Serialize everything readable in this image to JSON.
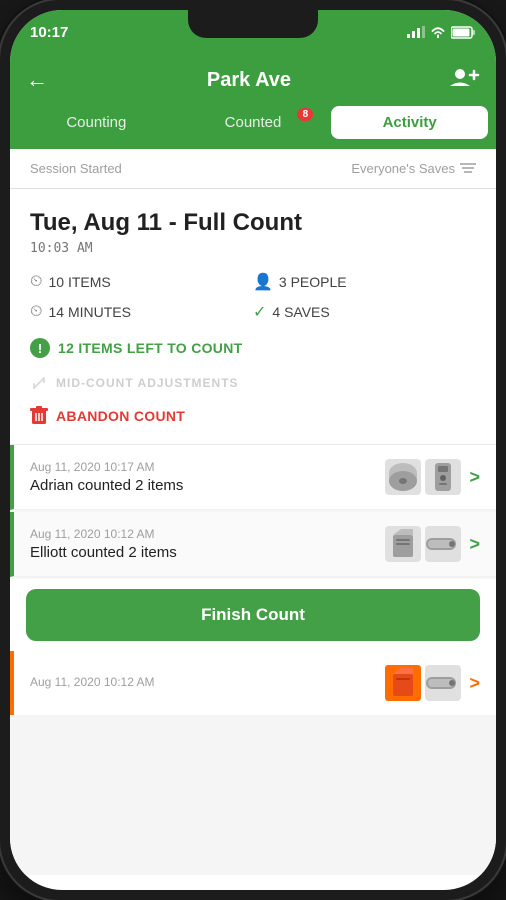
{
  "status_bar": {
    "time": "10:17",
    "signal": "▂▄▆",
    "wifi": "WiFi",
    "battery": "Battery"
  },
  "header": {
    "back_icon": "←",
    "title": "Park Ave",
    "add_icon": "👥+"
  },
  "tabs": [
    {
      "id": "counting",
      "label": "Counting",
      "active": false,
      "badge": null
    },
    {
      "id": "counted",
      "label": "Counted",
      "active": false,
      "badge": "8"
    },
    {
      "id": "activity",
      "label": "Activity",
      "active": true,
      "badge": null
    }
  ],
  "session": {
    "started_label": "Session Started",
    "filter_label": "Everyone's Saves",
    "filter_icon": "filter"
  },
  "activity_card": {
    "title": "Tue, Aug 11 - Full Count",
    "time": "10:03 AM",
    "stats": [
      {
        "icon": "clock",
        "value": "10 ITEMS"
      },
      {
        "icon": "person",
        "value": "3 PEOPLE"
      },
      {
        "icon": "clock",
        "value": "14 MINUTES"
      },
      {
        "icon": "check",
        "value": "4 SAVES"
      }
    ],
    "items_left": "12 ITEMS LEFT TO COUNT",
    "mid_count_label": "MID-COUNT ADJUSTMENTS",
    "abandon_label": "ABANDON COUNT"
  },
  "activity_list": [
    {
      "date": "Aug 11, 2020 10:17 AM",
      "description": "Adrian counted 2 items",
      "border_color": "#43a047",
      "chevron_color": "green",
      "thumbnails": [
        "disk",
        "tower"
      ]
    },
    {
      "date": "Aug 11, 2020 10:12 AM",
      "description": "Elliott counted 2 items",
      "border_color": "#43a047",
      "chevron_color": "green",
      "thumbnails": [
        "card",
        "drive"
      ]
    }
  ],
  "finish_button": {
    "label": "Finish Count"
  },
  "bottom_item": {
    "date": "Aug 11, 2020 10:12 AM",
    "border_color": "#ff6d00",
    "thumbnails": [
      "card",
      "mini-drive"
    ]
  }
}
